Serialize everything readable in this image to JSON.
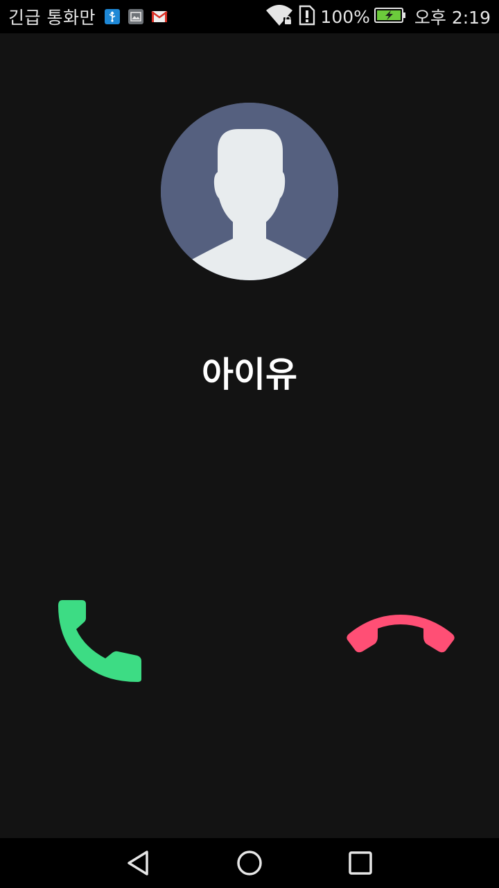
{
  "status_bar": {
    "carrier_text": "긴급 통화만",
    "notification_icons": [
      "usb-icon",
      "image-icon",
      "gmail-icon"
    ],
    "battery_percent": "100%",
    "time": "오후 2:19",
    "icons": [
      "wifi-icon",
      "sim-alert-icon",
      "battery-charging-icon"
    ]
  },
  "call": {
    "caller_name": "아이유",
    "avatar": "default-contact-avatar"
  },
  "actions": {
    "answer_icon": "phone-answer-icon",
    "decline_icon": "phone-hangup-icon"
  },
  "nav": {
    "buttons": [
      "back-icon",
      "home-icon",
      "recents-icon"
    ]
  },
  "colors": {
    "background": "#131313",
    "answer": "#3ddc84",
    "decline": "#ff4f75",
    "avatar_bg": "#55607f",
    "avatar_silhouette": "#e8ecee"
  }
}
